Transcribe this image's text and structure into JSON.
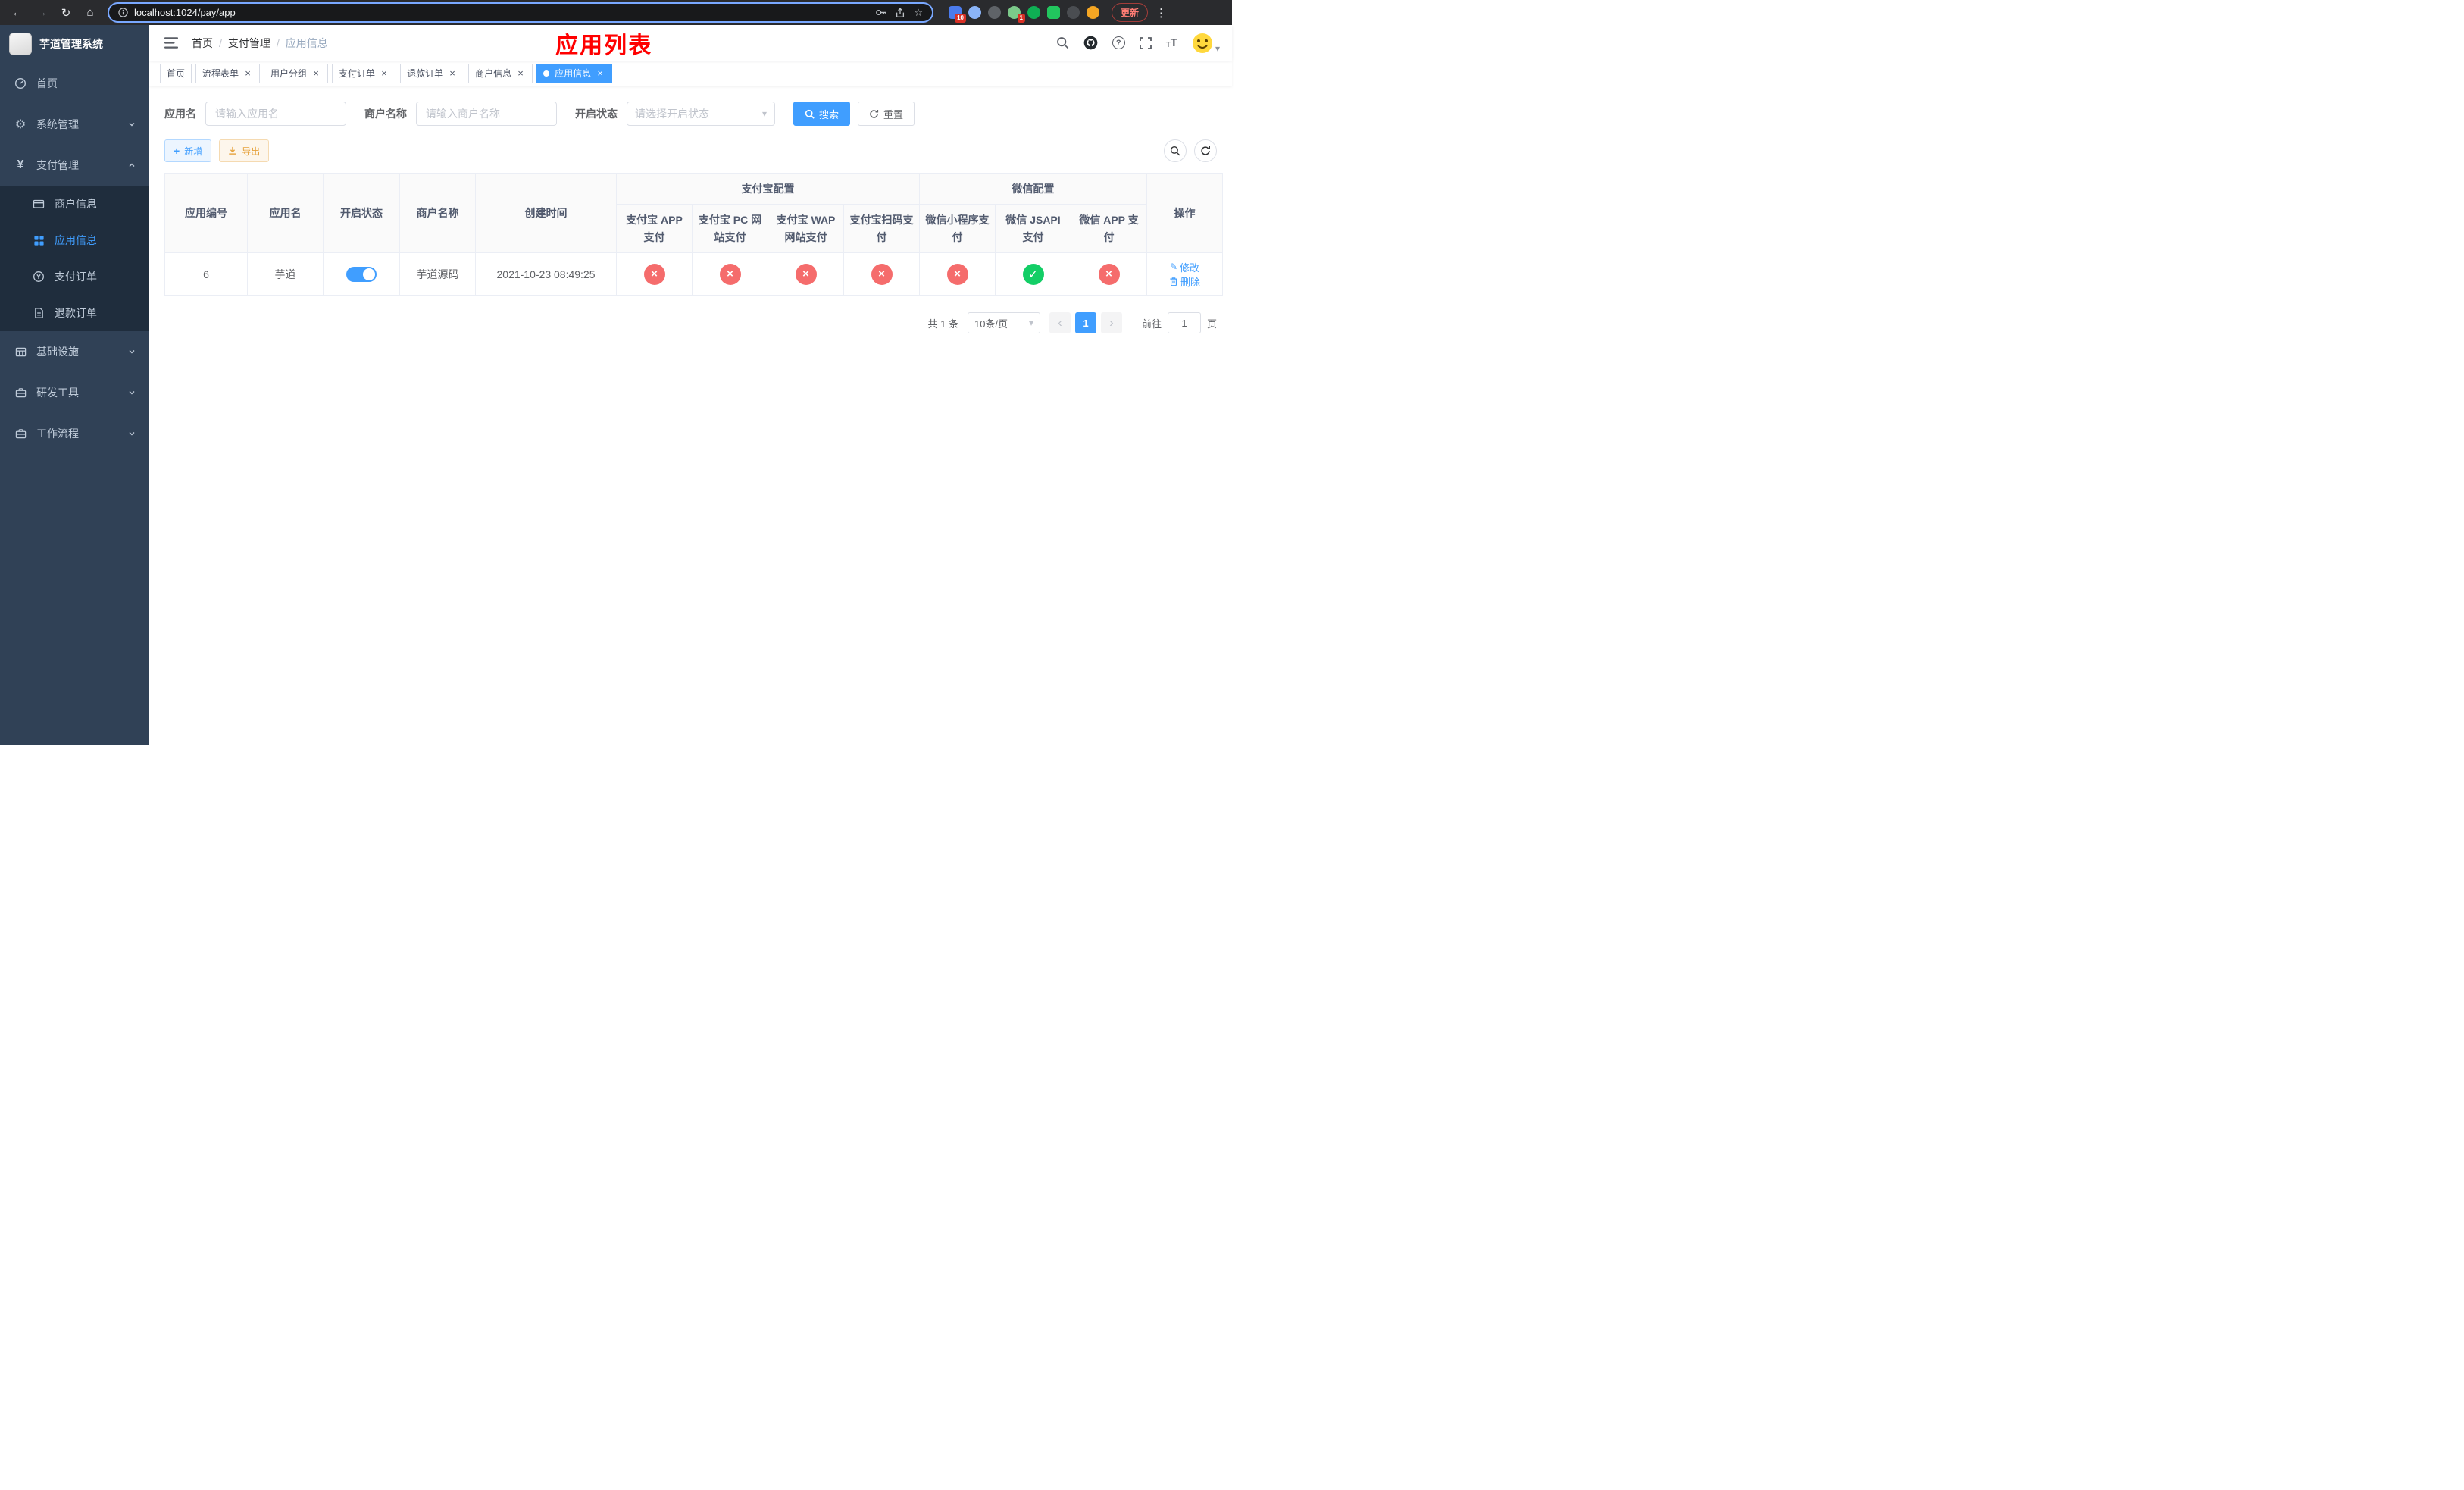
{
  "colors": {
    "accent": "#409eff",
    "success": "#13ce66",
    "danger": "#f56c6c",
    "warning": "#e6a23c",
    "annotation_red": "#ff0000",
    "sidebar_bg": "#304156",
    "sidebar_submenu_bg": "#1f2d3d"
  },
  "icons": {
    "back": "←",
    "forward": "→",
    "reload": "↻",
    "home": "⌂",
    "star": "☆",
    "menu_dots": "⋮",
    "gear": "⚙",
    "yen": "¥",
    "plus": "+",
    "caret_down": "▾",
    "close": "×",
    "check": "✓",
    "cross": "×",
    "prev": "‹",
    "next": "›",
    "edit": "✎",
    "question": "?",
    "font_size": "T"
  },
  "browser": {
    "url": "localhost:1024/pay/app",
    "update_label": "更新",
    "ext_badge_blue": "10",
    "ext_badge_green": "1"
  },
  "sidebar": {
    "title": "芋道管理系统",
    "items": [
      {
        "label": "首页"
      },
      {
        "label": "系统管理"
      },
      {
        "label": "支付管理"
      },
      {
        "label": "基础设施"
      },
      {
        "label": "研发工具"
      },
      {
        "label": "工作流程"
      }
    ],
    "payment_children": [
      {
        "label": "商户信息"
      },
      {
        "label": "应用信息"
      },
      {
        "label": "支付订单"
      },
      {
        "label": "退款订单"
      }
    ]
  },
  "header": {
    "breadcrumb": [
      "首页",
      "支付管理",
      "应用信息"
    ],
    "breadcrumb_sep": "/",
    "annotation": "应用列表"
  },
  "tabs": [
    {
      "label": "首页"
    },
    {
      "label": "流程表单"
    },
    {
      "label": "用户分组"
    },
    {
      "label": "支付订单"
    },
    {
      "label": "退款订单"
    },
    {
      "label": "商户信息"
    },
    {
      "label": "应用信息"
    }
  ],
  "filters": {
    "app_name_label": "应用名",
    "app_name_placeholder": "请输入应用名",
    "merchant_label": "商户名称",
    "merchant_placeholder": "请输入商户名称",
    "status_label": "开启状态",
    "status_placeholder": "请选择开启状态",
    "search_label": "搜索",
    "reset_label": "重置"
  },
  "toolbar": {
    "add_label": "新增",
    "export_label": "导出"
  },
  "table": {
    "headers": {
      "app_id": "应用编号",
      "app_name": "应用名",
      "status": "开启状态",
      "merchant": "商户名称",
      "created": "创建时间",
      "alipay_group": "支付宝配置",
      "wechat_group": "微信配置",
      "actions": "操作",
      "sub": [
        "支付宝 APP 支付",
        "支付宝 PC 网站支付",
        "支付宝 WAP 网站支付",
        "支付宝扫码支付",
        "微信小程序支付",
        "微信 JSAPI 支付",
        "微信 APP 支付"
      ]
    },
    "row": {
      "id": "6",
      "name": "芋道",
      "status_on": true,
      "merchant": "芋道源码",
      "created": "2021-10-23 08:49:25",
      "configs": [
        false,
        false,
        false,
        false,
        false,
        true,
        false
      ],
      "edit_label": "修改",
      "delete_label": "删除"
    }
  },
  "pagination": {
    "total": "共 1 条",
    "page_size": "10条/页",
    "current_page": "1",
    "goto_label": "前往",
    "goto_value": "1",
    "page_unit": "页"
  }
}
